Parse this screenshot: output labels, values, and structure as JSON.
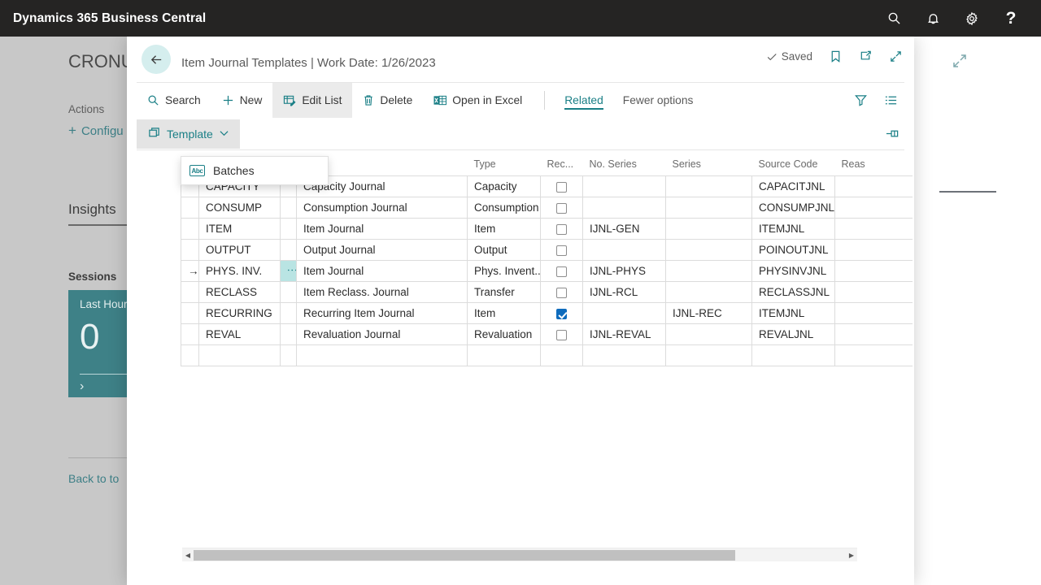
{
  "topbar": {
    "title": "Dynamics 365 Business Central",
    "icons": [
      "search-icon",
      "bell-icon",
      "gear-icon",
      "help-icon"
    ],
    "help_glyph": "?"
  },
  "background": {
    "company": "CRONU",
    "actions_label": "Actions",
    "configure_label": "Configu",
    "configure_plus": "+",
    "insights_label": "Insights",
    "sessions_label": "Sessions",
    "tile": {
      "label": "Last Hour",
      "value": "0",
      "chevron": "›"
    },
    "back_to_top": "Back to to"
  },
  "modal": {
    "title": "Item Journal Templates | Work Date: 1/26/2023",
    "saved_label": "Saved",
    "header_icons": [
      "bookmark-icon",
      "open-in-new-window-icon",
      "expand-icon"
    ],
    "toolbar": {
      "search_label": "Search",
      "new_label": "New",
      "edit_list_label": "Edit List",
      "delete_label": "Delete",
      "open_in_excel_label": "Open in Excel",
      "related_label": "Related",
      "fewer_options_label": "Fewer options",
      "filter_icon": "filter-icon",
      "list_icon": "list-view-icon"
    },
    "subbar": {
      "template_label": "Template",
      "template_caret": "⌄",
      "pin_icon": "pin-pane-icon"
    },
    "dropdown": {
      "open": true,
      "items": [
        {
          "label": "Batches",
          "icon": "abc-icon",
          "icon_text": "Abc"
        }
      ]
    }
  },
  "table": {
    "columns": [
      {
        "key": "indicator",
        "label": ""
      },
      {
        "key": "name",
        "label": ""
      },
      {
        "key": "dots",
        "label": ""
      },
      {
        "key": "description",
        "label": "iption"
      },
      {
        "key": "type",
        "label": "Type"
      },
      {
        "key": "recurring",
        "label": "Rec..."
      },
      {
        "key": "no_series",
        "label": "No. Series"
      },
      {
        "key": "series",
        "label": "Series"
      },
      {
        "key": "source_code",
        "label": "Source Code"
      },
      {
        "key": "reason",
        "label": "Reas"
      }
    ],
    "rows": [
      {
        "indicator": "",
        "name": "CAPACITY",
        "description": "Capacity Journal",
        "type": "Capacity",
        "recurring": false,
        "no_series": "",
        "series": "",
        "source_code": "CAPACITJNL",
        "reason": "",
        "selected": false
      },
      {
        "indicator": "",
        "name": "CONSUMP",
        "description": "Consumption Journal",
        "type": "Consumption",
        "recurring": false,
        "no_series": "",
        "series": "",
        "source_code": "CONSUMPJNL",
        "reason": "",
        "selected": false
      },
      {
        "indicator": "",
        "name": "ITEM",
        "description": "Item Journal",
        "type": "Item",
        "recurring": false,
        "no_series": "IJNL-GEN",
        "series": "",
        "source_code": "ITEMJNL",
        "reason": "",
        "selected": false
      },
      {
        "indicator": "",
        "name": "OUTPUT",
        "description": "Output Journal",
        "type": "Output",
        "recurring": false,
        "no_series": "",
        "series": "",
        "source_code": "POINOUTJNL",
        "reason": "",
        "selected": false
      },
      {
        "indicator": "→",
        "name": "PHYS. INV.",
        "description": "Item Journal",
        "type": "Phys. Invent...",
        "recurring": false,
        "no_series": "IJNL-PHYS",
        "series": "",
        "source_code": "PHYSINVJNL",
        "reason": "",
        "selected": true
      },
      {
        "indicator": "",
        "name": "RECLASS",
        "description": "Item Reclass. Journal",
        "type": "Transfer",
        "recurring": false,
        "no_series": "IJNL-RCL",
        "series": "",
        "source_code": "RECLASSJNL",
        "reason": "",
        "selected": false
      },
      {
        "indicator": "",
        "name": "RECURRING",
        "description": "Recurring Item Journal",
        "type": "Item",
        "recurring": true,
        "no_series": "",
        "series": "IJNL-REC",
        "source_code": "ITEMJNL",
        "reason": "",
        "selected": false
      },
      {
        "indicator": "",
        "name": "REVAL",
        "description": "Revaluation Journal",
        "type": "Revaluation",
        "recurring": false,
        "no_series": "IJNL-REVAL",
        "series": "",
        "source_code": "REVALJNL",
        "reason": "",
        "selected": false
      },
      {
        "indicator": "",
        "name": "",
        "description": "",
        "type": "",
        "recurring": null,
        "no_series": "",
        "series": "",
        "source_code": "",
        "reason": "",
        "selected": false
      }
    ]
  },
  "scrollbar": {
    "left_arrow": "◀",
    "right_arrow": "▶"
  },
  "colors": {
    "accent_teal": "#1a7f86",
    "topbar_black": "#252423",
    "tile_teal": "#3e8187",
    "checkbox_blue": "#0f6cbd",
    "selection_teal": "#b9e4e3",
    "dim_gray": "#c8c8c8"
  }
}
